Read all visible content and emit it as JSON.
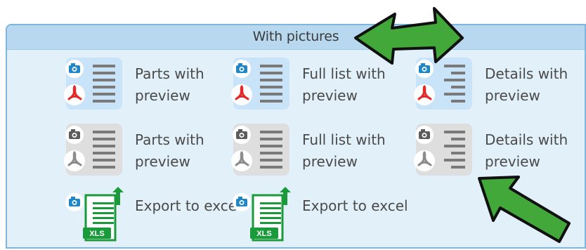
{
  "panel": {
    "title": "With pictures"
  },
  "rows": [
    {
      "style": "color",
      "items": [
        {
          "id": "parts-with-preview-color",
          "label": "Parts with preview",
          "icon": "camera-pdf-list-icon"
        },
        {
          "id": "full-list-with-preview-color",
          "label": "Full list with preview",
          "icon": "camera-pdf-list-icon"
        },
        {
          "id": "details-with-preview-color",
          "label": "Details with preview",
          "icon": "camera-pdf-indented-list-icon"
        }
      ]
    },
    {
      "style": "gray",
      "items": [
        {
          "id": "parts-with-preview-gray",
          "label": "Parts with preview",
          "icon": "camera-pdf-list-gray-icon"
        },
        {
          "id": "full-list-with-preview-gray",
          "label": "Full list with preview",
          "icon": "camera-pdf-list-gray-icon"
        },
        {
          "id": "details-with-preview-gray",
          "label": "Details with preview",
          "icon": "camera-pdf-indented-list-gray-icon"
        }
      ]
    },
    {
      "style": "excel",
      "items": [
        {
          "id": "export-to-excel-1",
          "label": "Export to excel",
          "icon": "camera-xls-export-icon",
          "badge": "XLS"
        },
        {
          "id": "export-to-excel-2",
          "label": "Export to excel",
          "icon": "camera-xls-export-icon",
          "badge": "XLS"
        }
      ]
    }
  ],
  "colors": {
    "panel_bg": "#e2f0f9",
    "header_bg": "#b7d8ee",
    "icon_tile_color": "#c9e3f8",
    "icon_tile_gray": "#dedede",
    "camera_blue": "#1f86c8",
    "pdf_red": "#e22828",
    "excel_green": "#1a9a3a",
    "arrow_green": "#43a83a"
  }
}
